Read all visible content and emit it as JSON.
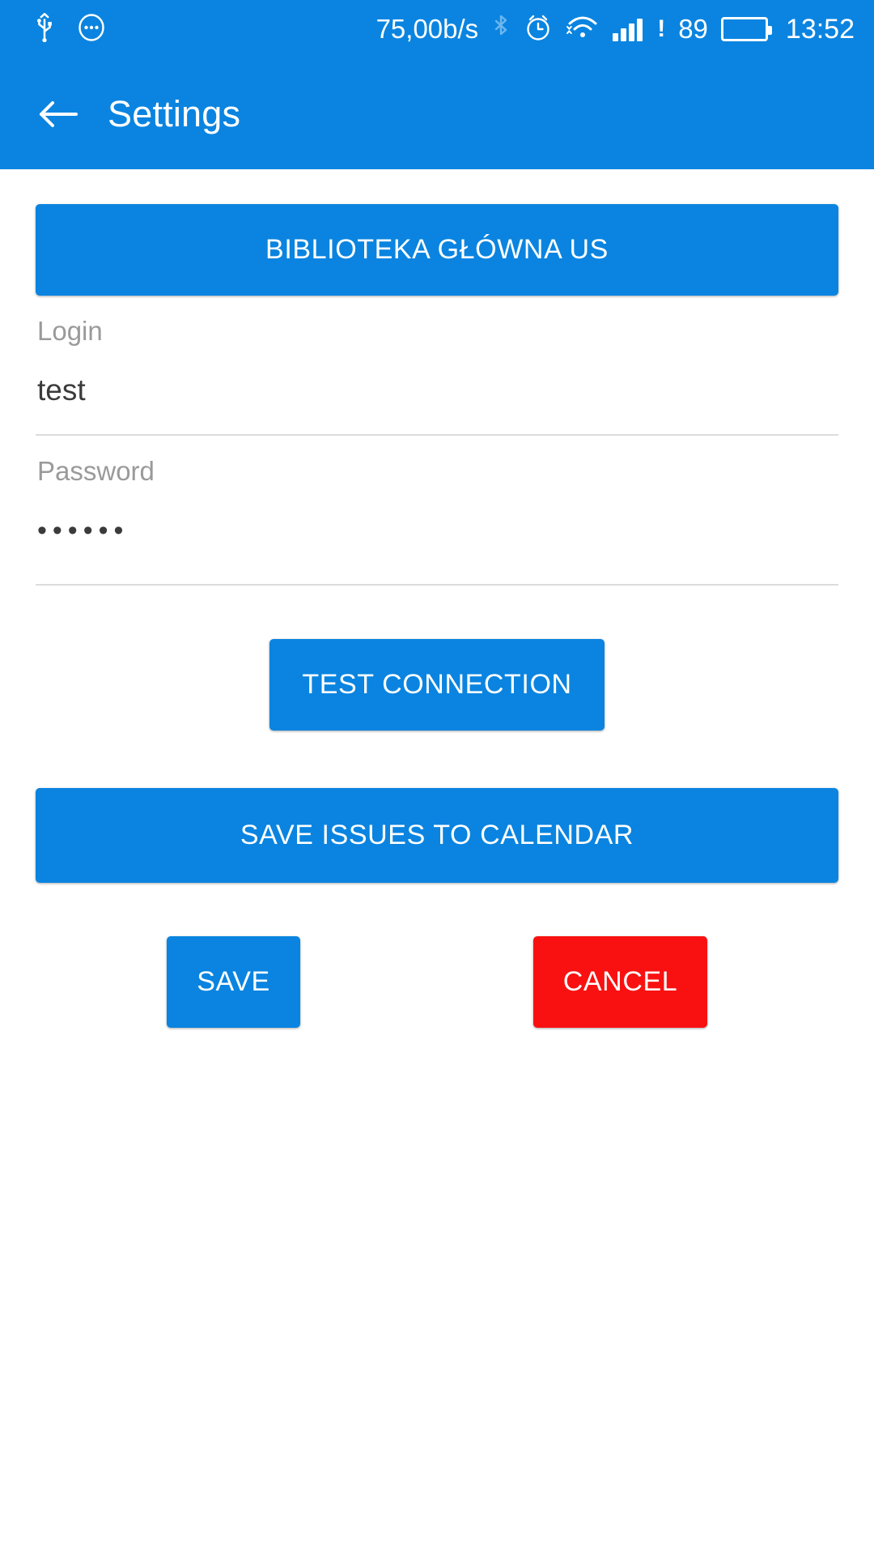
{
  "status_bar": {
    "usb_icon": "usb-icon",
    "more_icon": "more-circle-icon",
    "network_speed": "75,00b/s",
    "bluetooth_icon": "bluetooth-icon",
    "alarm_icon": "alarm-clock-icon",
    "wifi_icon": "wifi-icon",
    "signal_icon": "cellular-signal-icon",
    "signal_warning": "!",
    "battery_percent": "89",
    "battery_icon": "battery-icon",
    "battery_color": "#12e014",
    "time": "13:52"
  },
  "app_bar": {
    "back_icon": "back-arrow-icon",
    "title": "Settings",
    "background": "#0a84e0"
  },
  "form": {
    "library_button": "BIBLIOTEKA GŁÓWNA US",
    "login": {
      "label": "Login",
      "value": "test",
      "placeholder": "Login"
    },
    "password": {
      "label": "Password",
      "value": "••••••",
      "placeholder": "Password"
    },
    "test_connection_button": "TEST CONNECTION",
    "calendar_button": "SAVE ISSUES TO CALENDAR",
    "save_button": "SAVE",
    "cancel_button": "CANCEL"
  },
  "colors": {
    "primary": "#0a84e0",
    "danger": "#f91111",
    "label_gray": "#9a9a9a",
    "value_dark": "#3b3b3b"
  }
}
